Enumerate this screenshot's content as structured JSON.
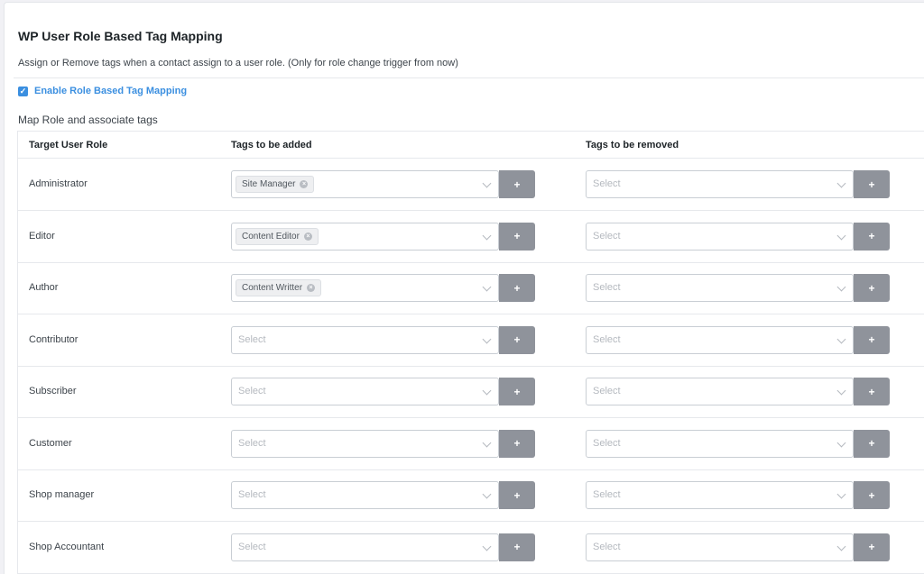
{
  "header": {
    "title": "WP User Role Based Tag Mapping",
    "description": "Assign or Remove tags when a contact assign to a user role. (Only for role change trigger from now)"
  },
  "enable": {
    "label": "Enable Role Based Tag Mapping",
    "checked": true,
    "accent": "#3b8fe0"
  },
  "section": {
    "title": "Map Role and associate tags"
  },
  "table": {
    "headers": {
      "role": "Target User Role",
      "add": "Tags to be added",
      "remove": "Tags to be removed"
    },
    "rows": [
      {
        "role": "Administrator",
        "add_tags": [
          "Site Manager"
        ],
        "remove_tags": []
      },
      {
        "role": "Editor",
        "add_tags": [
          "Content Editor"
        ],
        "remove_tags": []
      },
      {
        "role": "Author",
        "add_tags": [
          "Content Writter"
        ],
        "remove_tags": []
      },
      {
        "role": "Contributor",
        "add_tags": [],
        "remove_tags": []
      },
      {
        "role": "Subscriber",
        "add_tags": [],
        "remove_tags": []
      },
      {
        "role": "Customer",
        "add_tags": [],
        "remove_tags": []
      },
      {
        "role": "Shop manager",
        "add_tags": [],
        "remove_tags": []
      },
      {
        "role": "Shop Accountant",
        "add_tags": [],
        "remove_tags": []
      }
    ]
  },
  "select": {
    "placeholder": "Select",
    "add_button_label": "+"
  },
  "colors": {
    "add_button": "#8f939b",
    "border": "#c9ced4"
  }
}
